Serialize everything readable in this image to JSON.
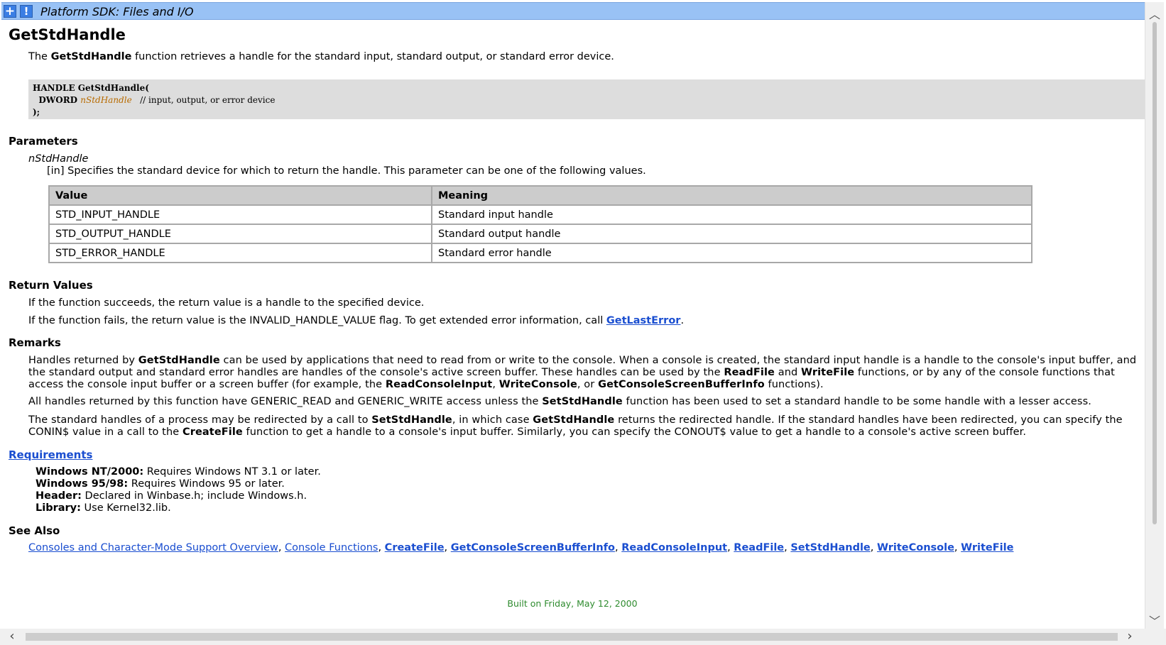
{
  "header": {
    "plus_label": "+",
    "bang_label": "!",
    "title": "Platform SDK: Files and I/O"
  },
  "page": {
    "title": "GetStdHandle",
    "intro": {
      "pre": "The ",
      "bold": "GetStdHandle",
      "post": " function retrieves a handle for the standard input, standard output, or standard error device."
    },
    "code": {
      "line1": "HANDLE GetStdHandle(",
      "line2_type": "  DWORD ",
      "line2_param": "nStdHandle",
      "line2_comment": "   // input, output, or error device",
      "line3": ");"
    }
  },
  "parameters": {
    "heading": "Parameters",
    "name": "nStdHandle",
    "description": "[in] Specifies the standard device for which to return the handle. This parameter can be one of the following values.",
    "table": {
      "headers": [
        "Value",
        "Meaning"
      ],
      "rows": [
        [
          "STD_INPUT_HANDLE",
          "Standard input handle"
        ],
        [
          "STD_OUTPUT_HANDLE",
          "Standard output handle"
        ],
        [
          "STD_ERROR_HANDLE",
          "Standard error handle"
        ]
      ]
    }
  },
  "return_values": {
    "heading": "Return Values",
    "line1": "If the function succeeds, the return value is a handle to the specified device.",
    "line2_pre": "If the function fails, the return value is the INVALID_HANDLE_VALUE flag. To get extended error information, call ",
    "line2_link": "GetLastError",
    "line2_post": "."
  },
  "remarks": {
    "heading": "Remarks",
    "p1": [
      {
        "t": "Handles returned by ",
        "b": false
      },
      {
        "t": "GetStdHandle",
        "b": true
      },
      {
        "t": " can be used by applications that need to read from or write to the console. When a console is created, the standard input handle is a handle to the console's input buffer, and the standard output and standard error handles are handles of the console's active screen buffer. These handles can be used by the ",
        "b": false
      },
      {
        "t": "ReadFile",
        "b": true
      },
      {
        "t": " and ",
        "b": false
      },
      {
        "t": "WriteFile",
        "b": true
      },
      {
        "t": " functions, or by any of the console functions that access the console input buffer or a screen buffer (for example, the ",
        "b": false
      },
      {
        "t": "ReadConsoleInput",
        "b": true
      },
      {
        "t": ", ",
        "b": false
      },
      {
        "t": "WriteConsole",
        "b": true
      },
      {
        "t": ", or ",
        "b": false
      },
      {
        "t": "GetConsoleScreenBufferInfo",
        "b": true
      },
      {
        "t": " functions).",
        "b": false
      }
    ],
    "p2": [
      {
        "t": "All handles returned by this function have GENERIC_READ and GENERIC_WRITE access unless the ",
        "b": false
      },
      {
        "t": "SetStdHandle",
        "b": true
      },
      {
        "t": " function has been used to set a standard handle to be some handle with a lesser access.",
        "b": false
      }
    ],
    "p3": [
      {
        "t": "The standard handles of a process may be redirected by a call to ",
        "b": false
      },
      {
        "t": "SetStdHandle",
        "b": true
      },
      {
        "t": ", in which case ",
        "b": false
      },
      {
        "t": "GetStdHandle",
        "b": true
      },
      {
        "t": " returns the redirected handle. If the standard handles have been redirected, you can specify the CONIN$ value in a call to the ",
        "b": false
      },
      {
        "t": "CreateFile",
        "b": true
      },
      {
        "t": " function to get a handle to a console's input buffer. Similarly, you can specify the CONOUT$ value to get a handle to a console's active screen buffer.",
        "b": false
      }
    ]
  },
  "requirements": {
    "heading": "Requirements",
    "items": [
      {
        "label": "Windows NT/2000:",
        "value": " Requires Windows NT 3.1 or later."
      },
      {
        "label": "Windows 95/98:",
        "value": " Requires Windows 95 or later."
      },
      {
        "label": "Header:",
        "value": " Declared in Winbase.h; include Windows.h."
      },
      {
        "label": "Library:",
        "value": " Use Kernel32.lib."
      }
    ]
  },
  "see_also": {
    "heading": "See Also",
    "links": [
      {
        "text": "Consoles and Character-Mode Support Overview",
        "bold": false
      },
      {
        "text": "Console Functions",
        "bold": false
      },
      {
        "text": "CreateFile",
        "bold": true
      },
      {
        "text": "GetConsoleScreenBufferInfo",
        "bold": true
      },
      {
        "text": "ReadConsoleInput",
        "bold": true
      },
      {
        "text": "ReadFile",
        "bold": true
      },
      {
        "text": "SetStdHandle",
        "bold": true
      },
      {
        "text": "WriteConsole",
        "bold": true
      },
      {
        "text": "WriteFile",
        "bold": true
      }
    ],
    "separator": ", "
  },
  "footer": {
    "text": "Built on Friday, May 12, 2000"
  },
  "scrollbars": {
    "up": "︿",
    "down": "﹀",
    "left": "‹",
    "right": "›"
  },
  "colors": {
    "header_bg": "#99c2f5",
    "button_bg": "#3a7ee4",
    "link": "#1a4ed0",
    "code_bg": "#dddddd",
    "param_color": "#b86b00",
    "footer_text": "#2e8b2e"
  }
}
